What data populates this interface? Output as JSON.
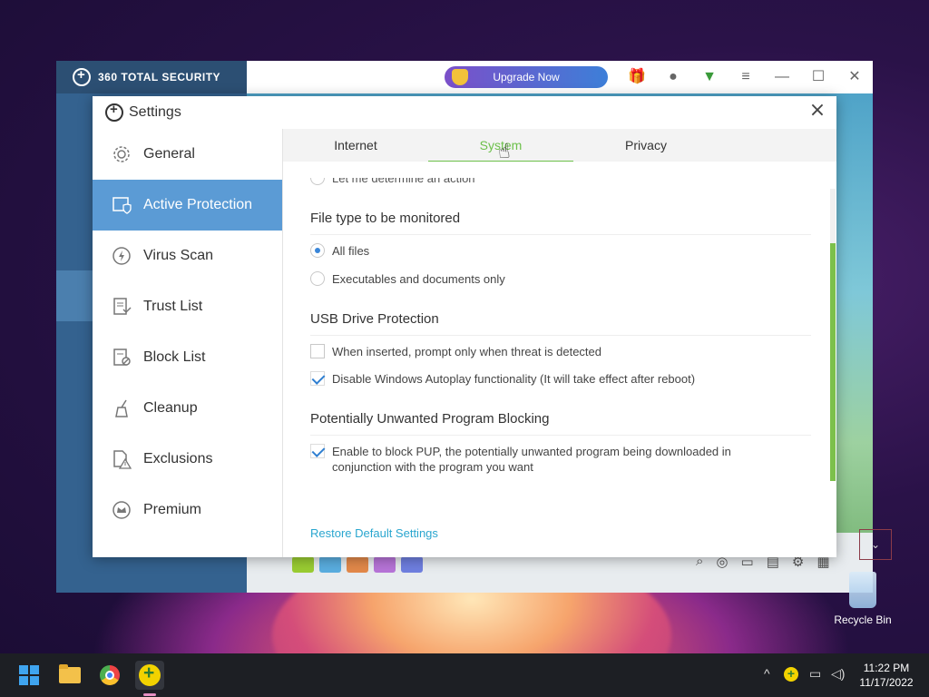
{
  "main_window": {
    "brand": "360 TOTAL SECURITY",
    "upgrade_label": "Upgrade Now"
  },
  "dialog": {
    "title": "Settings",
    "nav": [
      {
        "label": "General",
        "icon": "gear-icon"
      },
      {
        "label": "Active Protection",
        "icon": "shield-monitor-icon",
        "active": true
      },
      {
        "label": "Virus Scan",
        "icon": "scan-bolt-icon"
      },
      {
        "label": "Trust List",
        "icon": "trust-list-icon"
      },
      {
        "label": "Block List",
        "icon": "block-list-icon"
      },
      {
        "label": "Cleanup",
        "icon": "broom-icon"
      },
      {
        "label": "Exclusions",
        "icon": "exclusion-icon"
      },
      {
        "label": "Premium",
        "icon": "crown-icon"
      }
    ],
    "tabs": [
      {
        "label": "Internet"
      },
      {
        "label": "System",
        "active": true
      },
      {
        "label": "Privacy"
      }
    ],
    "cut_option": "Let me determine an action",
    "sections": {
      "file_type": {
        "title": "File type to be monitored",
        "options": [
          {
            "label": "All files",
            "selected": true
          },
          {
            "label": "Executables and documents only",
            "selected": false
          }
        ]
      },
      "usb": {
        "title": "USB Drive Protection",
        "options": [
          {
            "label": "When inserted, prompt only when threat is detected",
            "checked": false
          },
          {
            "label": "Disable Windows Autoplay functionality (It will take effect after reboot)",
            "checked": true
          }
        ]
      },
      "pup": {
        "title": "Potentially Unwanted Program Blocking",
        "options": [
          {
            "label": "Enable to block PUP, the potentially unwanted program being downloaded in conjunction with the program you want",
            "checked": true
          }
        ]
      }
    },
    "restore_label": "Restore Default Settings"
  },
  "desktop": {
    "recycle_bin": "Recycle Bin"
  },
  "taskbar": {
    "time": "11:22 PM",
    "date": "11/17/2022"
  }
}
